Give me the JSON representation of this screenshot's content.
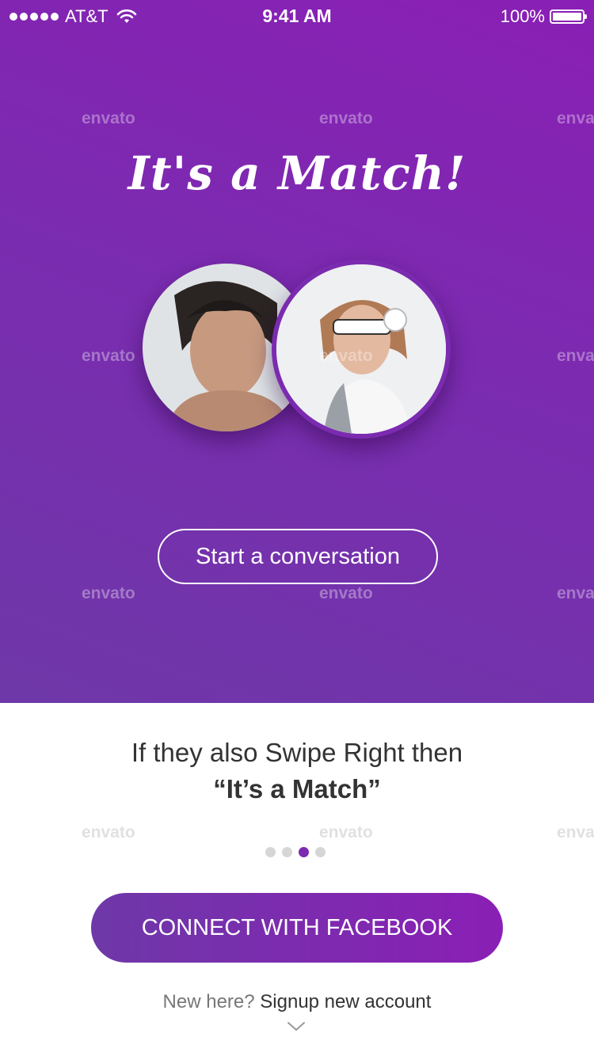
{
  "status_bar": {
    "carrier": "AT&T",
    "time": "9:41 AM",
    "battery": "100%"
  },
  "match": {
    "title": "It's a Match!",
    "cta_label": "Start a conversation"
  },
  "info": {
    "line1": "If they also Swipe Right then",
    "line2": "“It’s a Match”"
  },
  "pager": {
    "count": 4,
    "active_index": 2
  },
  "actions": {
    "facebook_label": "CONNECT WITH FACEBOOK",
    "signup_question": "New here?",
    "signup_link": "Signup new account"
  },
  "watermark": "envato",
  "colors": {
    "accent": "#7b2bb0",
    "gradient_start": "#6e38a8",
    "gradient_end": "#8a1fb5"
  }
}
